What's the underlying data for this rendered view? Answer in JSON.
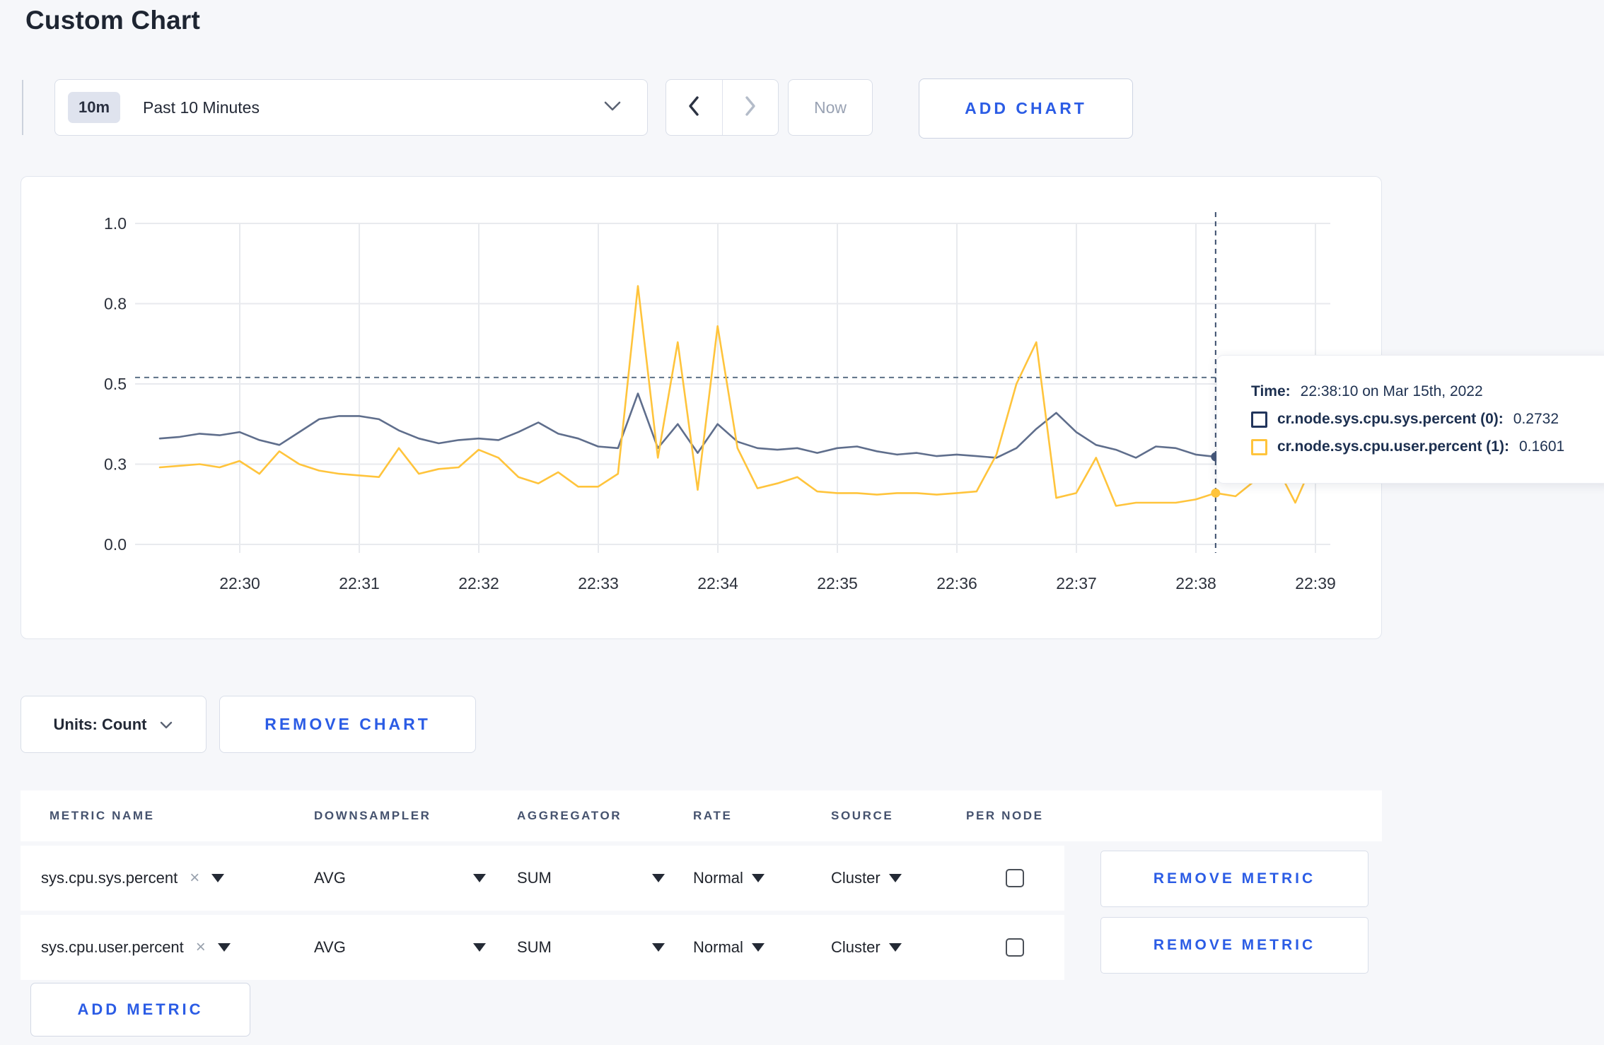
{
  "page": {
    "title": "Custom Chart"
  },
  "toolbar": {
    "range_badge": "10m",
    "range_label": "Past 10 Minutes",
    "prev_label": "previous time window",
    "next_label": "next time window",
    "now_label": "Now",
    "add_chart_label": "ADD CHART"
  },
  "tooltip": {
    "time_label": "Time:",
    "time_value": "22:38:10 on Mar 15th, 2022",
    "series": [
      {
        "name": "cr.node.sys.cpu.sys.percent (0):",
        "value": "0.2732",
        "color": "#22355c"
      },
      {
        "name": "cr.node.sys.cpu.user.percent (1):",
        "value": "0.1601",
        "color": "#ffc43c"
      }
    ]
  },
  "chart_controls": {
    "units_label": "Units: Count",
    "remove_chart_label": "REMOVE CHART"
  },
  "metrics_table": {
    "headers": [
      "METRIC NAME",
      "DOWNSAMPLER",
      "AGGREGATOR",
      "RATE",
      "SOURCE",
      "PER NODE"
    ],
    "rows": [
      {
        "metric": "sys.cpu.sys.percent",
        "downsampler": "AVG",
        "aggregator": "SUM",
        "rate": "Normal",
        "source": "Cluster",
        "per_node_checked": false,
        "remove_label": "REMOVE METRIC"
      },
      {
        "metric": "sys.cpu.user.percent",
        "downsampler": "AVG",
        "aggregator": "SUM",
        "rate": "Normal",
        "source": "Cluster",
        "per_node_checked": false,
        "remove_label": "REMOVE METRIC"
      }
    ],
    "add_metric_label": "ADD METRIC"
  },
  "chart_data": {
    "type": "line",
    "title": "",
    "xlabel": "",
    "ylabel": "",
    "ylim": [
      0,
      1
    ],
    "grid": true,
    "x_start": "22:29:20",
    "x_step_seconds": 10,
    "x_tick_labels": [
      "22:30",
      "22:31",
      "22:32",
      "22:33",
      "22:34",
      "22:35",
      "22:36",
      "22:37",
      "22:38",
      "22:39"
    ],
    "y_tick_values": [
      0,
      0.25,
      0.5,
      0.75,
      1.0
    ],
    "y_tick_labels": [
      "0.0",
      "0.3",
      "0.5",
      "0.8",
      "1.0"
    ],
    "threshold_dashed_line": 0.52,
    "crosshair": {
      "time": "22:38:10",
      "index": 53,
      "sys_value": 0.2732,
      "user_value": 0.1601
    },
    "series": [
      {
        "name": "cr.node.sys.cpu.sys.percent",
        "color": "#5f6e8c",
        "values": [
          0.33,
          0.335,
          0.345,
          0.34,
          0.35,
          0.325,
          0.31,
          0.35,
          0.39,
          0.4,
          0.4,
          0.39,
          0.355,
          0.33,
          0.315,
          0.325,
          0.33,
          0.325,
          0.35,
          0.38,
          0.345,
          0.33,
          0.305,
          0.3,
          0.47,
          0.3,
          0.375,
          0.285,
          0.375,
          0.32,
          0.3,
          0.295,
          0.3,
          0.285,
          0.3,
          0.305,
          0.29,
          0.28,
          0.285,
          0.275,
          0.28,
          0.275,
          0.27,
          0.3,
          0.36,
          0.41,
          0.35,
          0.31,
          0.295,
          0.27,
          0.305,
          0.3,
          0.28,
          0.273,
          0.3,
          0.31,
          0.3,
          0.295,
          0.3
        ]
      },
      {
        "name": "cr.node.sys.cpu.user.percent",
        "color": "#ffc43c",
        "values": [
          0.24,
          0.245,
          0.25,
          0.24,
          0.26,
          0.22,
          0.29,
          0.25,
          0.23,
          0.22,
          0.215,
          0.21,
          0.3,
          0.22,
          0.235,
          0.24,
          0.295,
          0.27,
          0.21,
          0.19,
          0.225,
          0.18,
          0.18,
          0.22,
          0.805,
          0.27,
          0.63,
          0.17,
          0.68,
          0.3,
          0.175,
          0.19,
          0.21,
          0.165,
          0.16,
          0.16,
          0.155,
          0.16,
          0.16,
          0.155,
          0.16,
          0.165,
          0.28,
          0.5,
          0.63,
          0.145,
          0.16,
          0.27,
          0.12,
          0.13,
          0.13,
          0.13,
          0.14,
          0.1601,
          0.15,
          0.2,
          0.25,
          0.13,
          0.27
        ]
      }
    ]
  }
}
